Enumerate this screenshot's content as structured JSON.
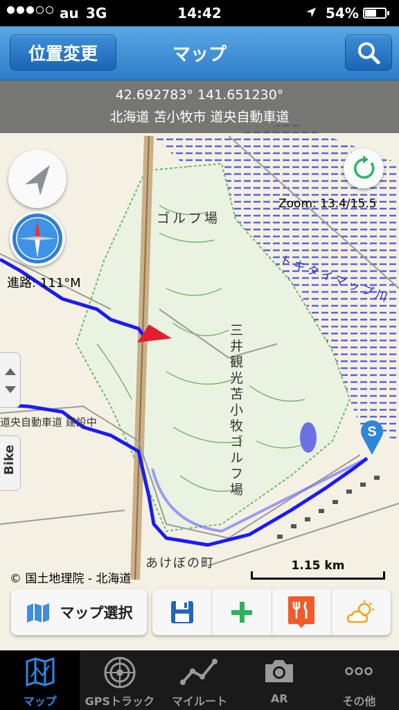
{
  "status_bar": {
    "carrier": "au",
    "network": "3G",
    "time": "14:42",
    "battery": "54%"
  },
  "nav": {
    "left_button": "位置変更",
    "title": "マップ",
    "right_icon": "search-icon"
  },
  "map": {
    "coords": "42.692783° 141.651230°",
    "address": "北海道 苫小牧市 道央自動車道",
    "zoom": "Zoom: 13.4/15.5",
    "heading": "進路: 111°M",
    "labels": {
      "golf_top": "ゴルフ場",
      "golf_name": "三井観光苫小牧ゴルフ場",
      "river": "トキタイマップ川",
      "under_construction": "道央自動車道 建設中",
      "akebono": "あけぼの町"
    },
    "copyright": "© 国土地理院 - 北海道",
    "scale": "1.15 km",
    "side_tab_bike": "Bike",
    "pin_letter": "S"
  },
  "toolbar": {
    "map_select": "マップ選択",
    "actions": [
      "save-icon",
      "add-icon",
      "restaurant-icon",
      "weather-icon"
    ]
  },
  "tabs": [
    {
      "label": "マップ",
      "icon": "map-icon"
    },
    {
      "label": "GPSトラック",
      "icon": "radar-icon"
    },
    {
      "label": "マイルート",
      "icon": "route-icon"
    },
    {
      "label": "AR",
      "icon": "camera-icon"
    },
    {
      "label": "その他",
      "icon": "more-icon"
    }
  ],
  "colors": {
    "accent": "#2c8ce8",
    "track": "#1a1aff",
    "heading_arrow": "#e02030"
  }
}
